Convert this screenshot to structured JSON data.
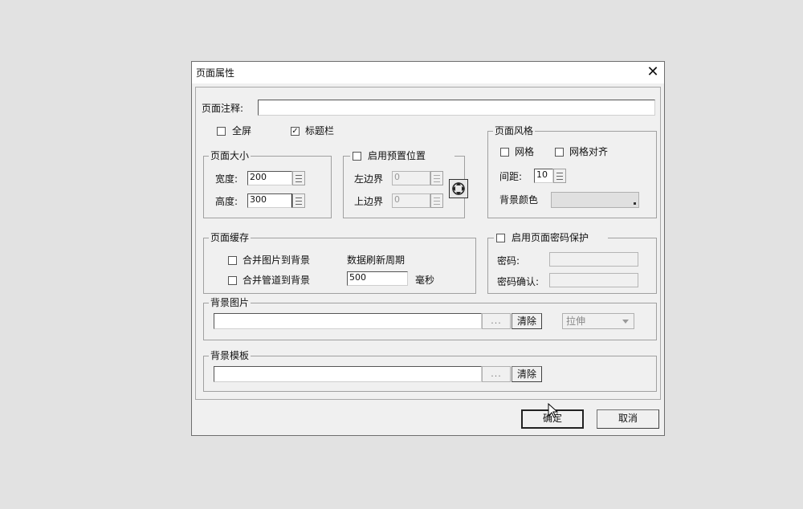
{
  "dialog": {
    "title": "页面属性",
    "close": "✕"
  },
  "note": {
    "label": "页面注释:",
    "value": ""
  },
  "checks": {
    "fullscreen": {
      "label": "全屏",
      "checked": false
    },
    "titlebar": {
      "label": "标题栏",
      "checked": true
    }
  },
  "page_size": {
    "title": "页面大小",
    "width_label": "宽度:",
    "width_value": "200",
    "height_label": "高度:",
    "height_value": "300"
  },
  "position": {
    "title": "启用预置位置",
    "checked": false,
    "left_label": "左边界",
    "left_value": "0",
    "top_label": "上边界",
    "top_value": "0"
  },
  "style": {
    "title": "页面风格",
    "grid_label": "网格",
    "grid_align_label": "网格对齐",
    "spacing_label": "间距:",
    "spacing_value": "10",
    "bgcolor_label": "背景颜色"
  },
  "cache": {
    "title": "页面缓存",
    "merge_image_label": "合并图片到背景",
    "merge_pipe_label": "合并管道到背景",
    "refresh_label": "数据刷新周期",
    "refresh_value": "500",
    "unit_label": "毫秒"
  },
  "password": {
    "title": "启用页面密码保护",
    "pw_label": "密码:",
    "confirm_label": "密码确认:"
  },
  "bg_image": {
    "title": "背景图片",
    "browse": "...",
    "clear": "清除",
    "mode": "拉伸"
  },
  "bg_template": {
    "title": "背景模板",
    "browse": "...",
    "clear": "清除"
  },
  "footer": {
    "ok": "确定",
    "cancel": "取消"
  },
  "check_glyph": "✓"
}
